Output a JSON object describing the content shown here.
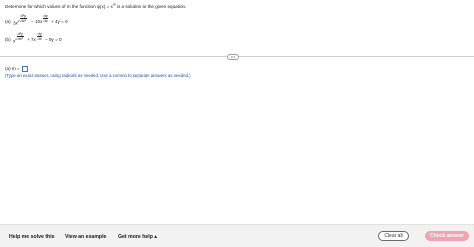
{
  "question": {
    "prefix": "Determine for which values of m the function",
    "function": "φ(x) = x",
    "exponent": "m",
    "suffix": "is a solution to the given equation."
  },
  "equations": {
    "a": {
      "label": "(a)",
      "lead": "3x",
      "lead_exp": "2",
      "frac1_num": "d²y",
      "frac1_den": "dx²",
      "mid": "− 10x",
      "frac2_num": "dy",
      "frac2_den": "dx",
      "tail": "+ 4y = 0"
    },
    "b": {
      "label": "(b)",
      "lead": "x",
      "lead_exp": "2",
      "frac1_num": "d²y",
      "frac1_den": "dx²",
      "mid": "+ 7x",
      "frac2_num": "dy",
      "frac2_den": "dx",
      "tail": "− 9y = 0"
    }
  },
  "divider_handle": "•••",
  "answer": {
    "label": "(a) m =",
    "value": "",
    "hint": "(Type an exact answer, using radicals as needed. Use a comma to separate answers as needed.)"
  },
  "footer": {
    "help_label": "Help me solve this",
    "example_label": "View an example",
    "more_help_label": "Get more help ▴",
    "clear_label": "Clear all",
    "check_label": "Check answer"
  },
  "colors": {
    "accent": "#3d7bd6",
    "hint_text": "#1f4fa8",
    "check_button": "#f0a3b0"
  }
}
